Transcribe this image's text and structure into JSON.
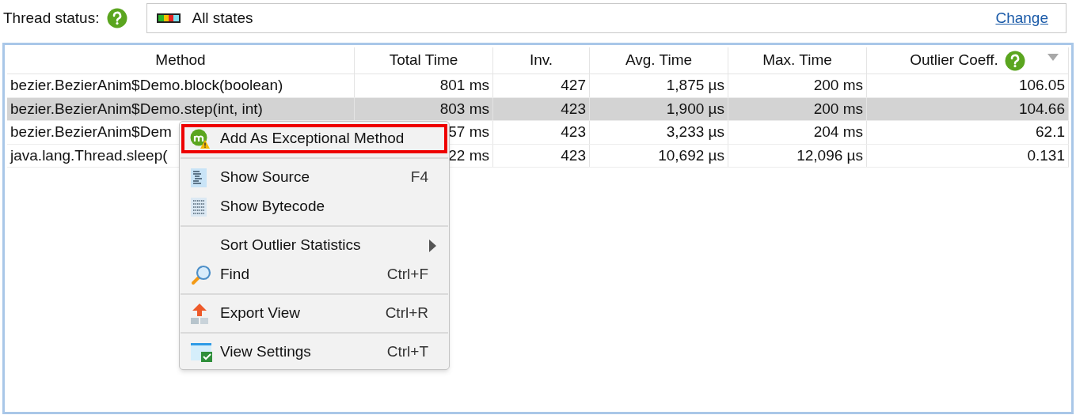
{
  "filter": {
    "label": "Thread status:",
    "value": "All states",
    "link": "Change"
  },
  "table": {
    "columns": [
      {
        "label": "Method",
        "help": false,
        "sorted": false
      },
      {
        "label": "Total Time",
        "help": false,
        "sorted": false
      },
      {
        "label": "Inv.",
        "help": false,
        "sorted": false
      },
      {
        "label": "Avg. Time",
        "help": false,
        "sorted": false
      },
      {
        "label": "Max. Time",
        "help": false,
        "sorted": false
      },
      {
        "label": "Outlier Coeff.",
        "help": true,
        "sorted": true
      }
    ],
    "rows": [
      {
        "selected": false,
        "cells": [
          "bezier.BezierAnim$Demo.block(boolean)",
          "801 ms",
          "427",
          "1,875 µs",
          "200 ms",
          "106.05"
        ]
      },
      {
        "selected": true,
        "cells": [
          "bezier.BezierAnim$Demo.step(int, int)",
          "803 ms",
          "423",
          "1,900 µs",
          "200 ms",
          "104.66"
        ]
      },
      {
        "selected": false,
        "cells": [
          "bezier.BezierAnim$Dem",
          "57 ms",
          "423",
          "3,233 µs",
          "204 ms",
          "62.1"
        ]
      },
      {
        "selected": false,
        "cells": [
          "java.lang.Thread.sleep(",
          "22 ms",
          "423",
          "10,692 µs",
          "12,096 µs",
          "0.131"
        ]
      }
    ]
  },
  "context_menu": {
    "items": [
      {
        "kind": "item",
        "label": "Add As Exceptional Method",
        "highlighted": true
      },
      {
        "kind": "separator"
      },
      {
        "kind": "item",
        "label": "Show Source",
        "shortcut": "F4",
        "highlighted": false
      },
      {
        "kind": "item",
        "label": "Show Bytecode",
        "highlighted": false
      },
      {
        "kind": "separator"
      },
      {
        "kind": "submenu",
        "label": "Sort Outlier Statistics",
        "highlighted": false
      },
      {
        "kind": "item",
        "label": "Find",
        "shortcut": "Ctrl+F",
        "highlighted": false
      },
      {
        "kind": "separator"
      },
      {
        "kind": "item",
        "label": "Export View",
        "shortcut": "Ctrl+R",
        "highlighted": false
      },
      {
        "kind": "separator"
      },
      {
        "kind": "item",
        "label": "View Settings",
        "shortcut": "Ctrl+T",
        "highlighted": false
      }
    ]
  }
}
